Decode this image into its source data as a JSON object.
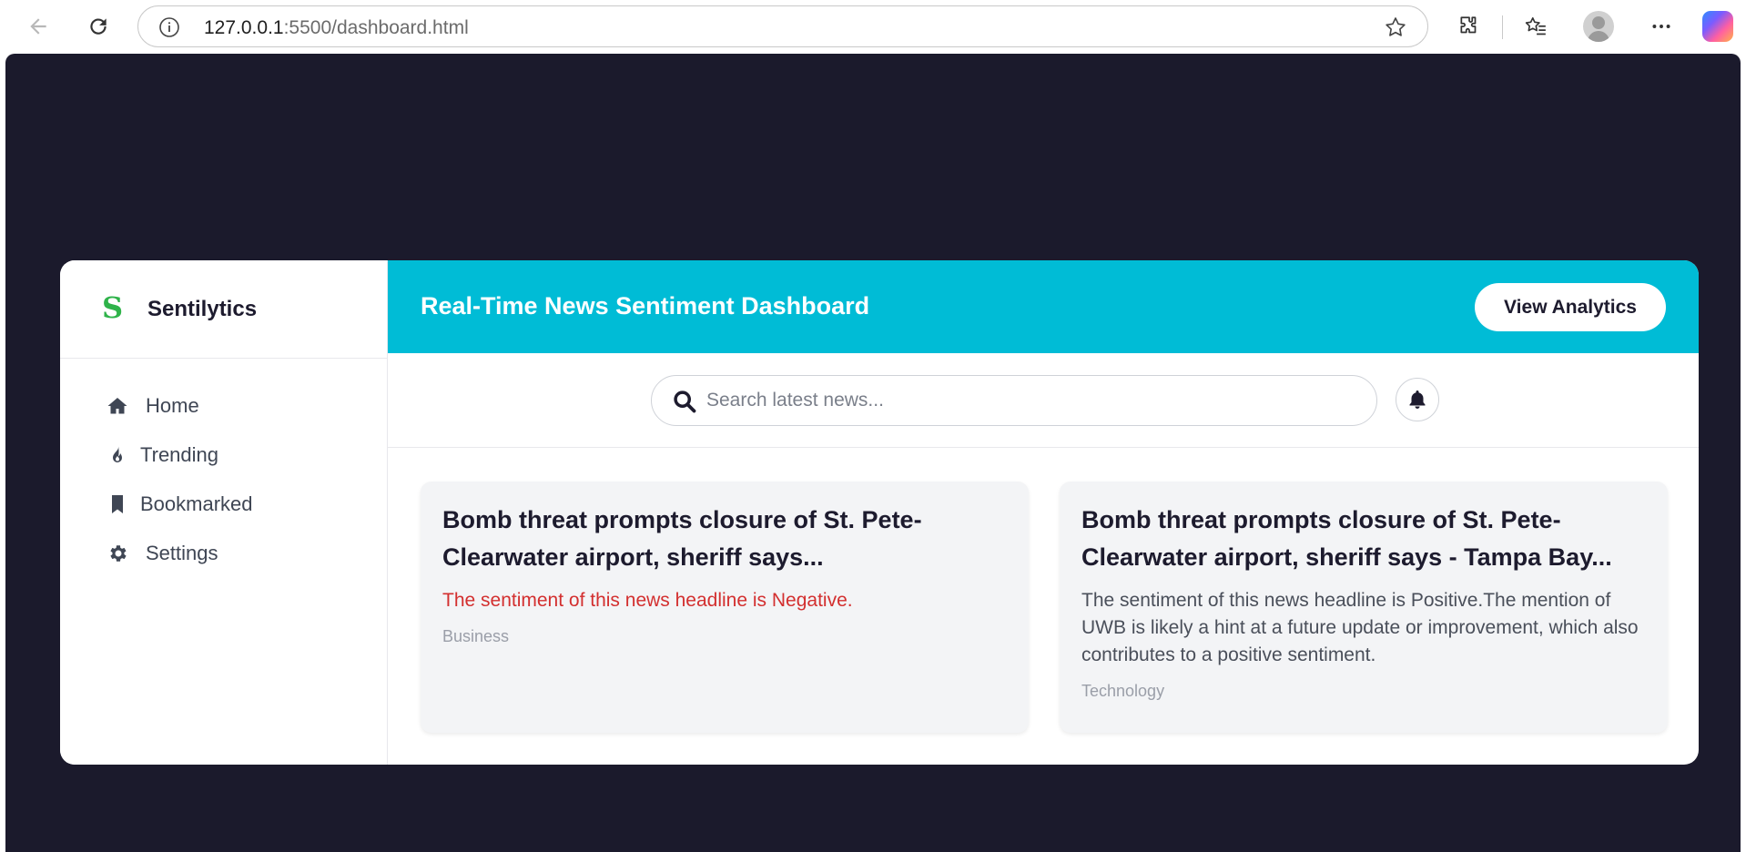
{
  "browser": {
    "url_host": "127.0.0.1",
    "url_rest": ":5500/dashboard.html"
  },
  "sidebar": {
    "brand_letter": "S",
    "brand_name": "Sentilytics",
    "items": [
      {
        "label": "Home",
        "icon": "home-icon"
      },
      {
        "label": "Trending",
        "icon": "fire-icon"
      },
      {
        "label": "Bookmarked",
        "icon": "bookmark-icon"
      },
      {
        "label": "Settings",
        "icon": "gear-icon"
      }
    ]
  },
  "header": {
    "title": "Real-Time News Sentiment Dashboard",
    "analytics_label": "View Analytics"
  },
  "search": {
    "placeholder": "Search latest news..."
  },
  "cards": [
    {
      "headline": "Bomb threat prompts closure of St. Pete-Clearwater airport, sheriff says...",
      "sentiment": "The sentiment of this news headline is Negative.",
      "category": "Business"
    },
    {
      "headline": "Bomb threat prompts closure of St. Pete-Clearwater airport, sheriff says - Tampa Bay...",
      "sentiment": "The sentiment of this news headline is Positive.The mention of UWB is likely a hint at a future update or improvement, which also contributes to a positive sentiment.",
      "category": "Technology"
    }
  ],
  "colors": {
    "accent": "#00bcd6",
    "background": "#1b1a2c",
    "negative": "#d32f2f",
    "brand": "#2fb34a"
  }
}
